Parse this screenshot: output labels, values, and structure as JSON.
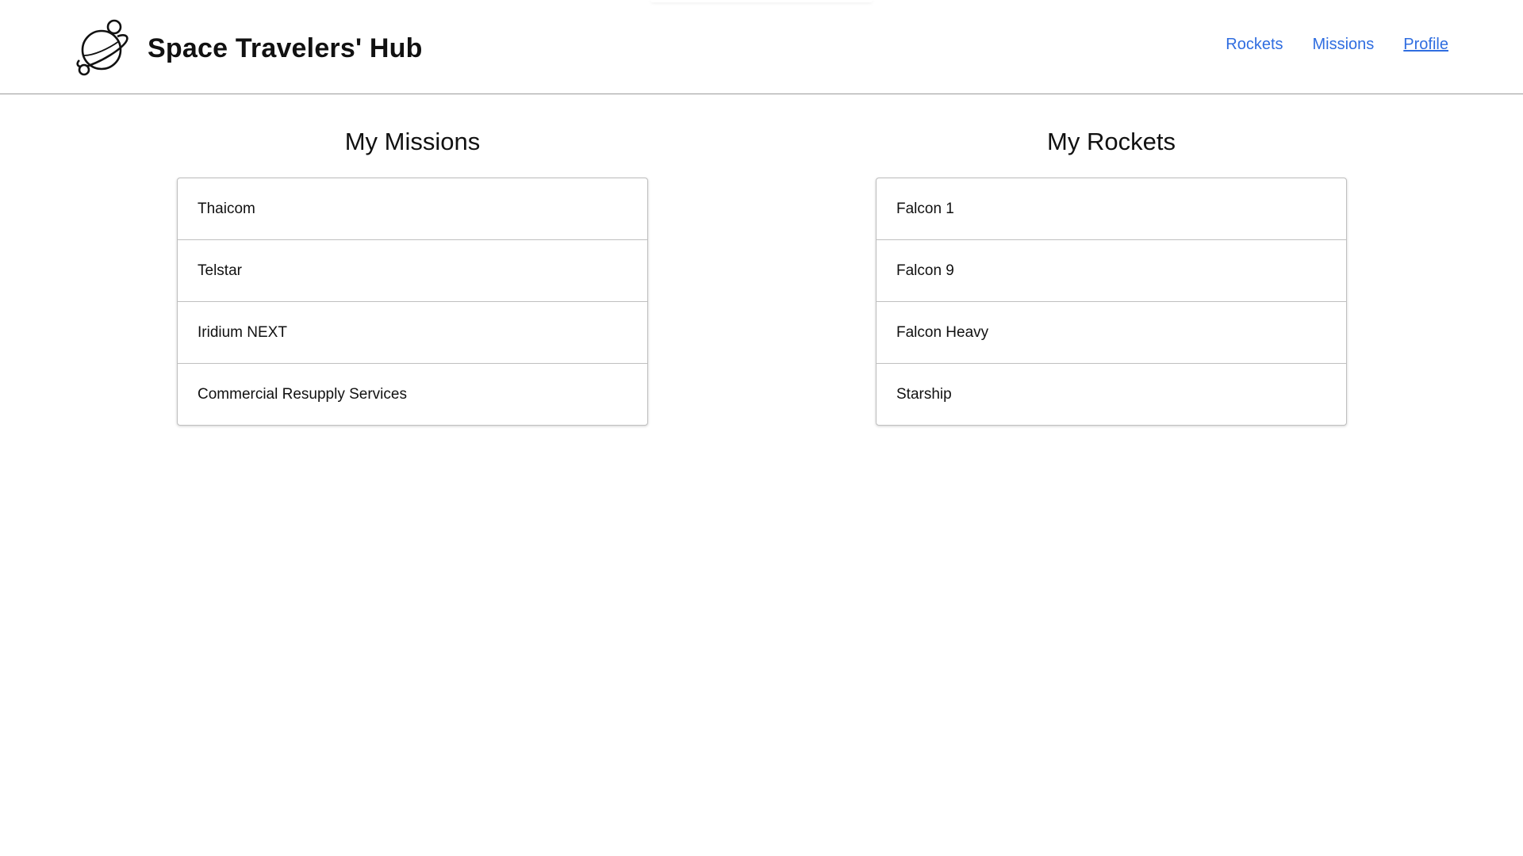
{
  "header": {
    "logo_icon": "planet-icon",
    "title": "Space Travelers' Hub"
  },
  "nav": {
    "items": [
      {
        "label": "Rockets"
      },
      {
        "label": "Missions"
      },
      {
        "label": "Profile"
      }
    ],
    "active": "Profile",
    "link_color": "#2f6de0"
  },
  "missions": {
    "title": "My Missions",
    "items": [
      "Thaicom",
      "Telstar",
      "Iridium NEXT",
      "Commercial Resupply Services"
    ]
  },
  "rockets": {
    "title": "My Rockets",
    "items": [
      "Falcon 1",
      "Falcon 9",
      "Falcon Heavy",
      "Starship"
    ]
  }
}
